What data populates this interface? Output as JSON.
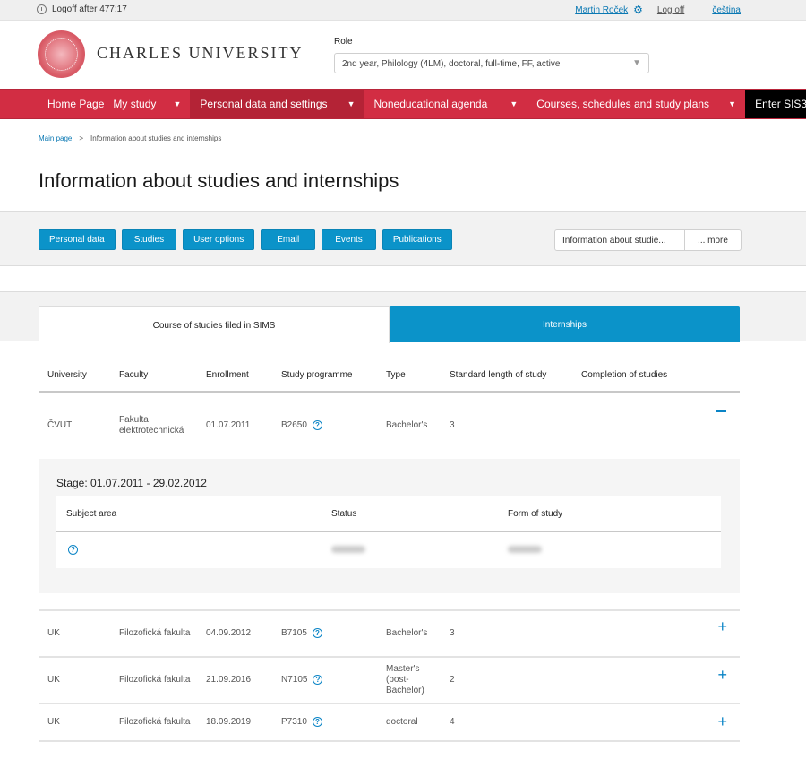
{
  "topbar": {
    "logoff_text": "Logoff after 477:17",
    "user_name": "Martin Roček",
    "logoff_link": "Log off",
    "language_link": "čeština"
  },
  "header": {
    "brand": "CHARLES UNIVERSITY",
    "role_label": "Role",
    "role_value": "2nd year, Philology (4LM), doctoral, full-time, FF, active"
  },
  "nav": {
    "items": [
      {
        "label": "Home Page"
      },
      {
        "label": "My study"
      },
      {
        "label": "Personal data and settings"
      },
      {
        "label": "Noneducational agenda"
      },
      {
        "label": "Courses, schedules and study plans"
      },
      {
        "label": "Enter SIS3"
      }
    ],
    "accent_color": "#d22d43"
  },
  "breadcrumb": {
    "home": "Main page",
    "separator": ">",
    "current": "Information about studies and internships"
  },
  "page_title": "Information about studies and internships",
  "subnav": {
    "buttons": [
      "Personal data",
      "Studies",
      "User options",
      "Email",
      "Events",
      "Publications"
    ],
    "current": "Information about studie...",
    "more": "... more"
  },
  "tabs": [
    {
      "label": "Course of studies filed in SIMS",
      "active": true
    },
    {
      "label": "Internships",
      "active": false
    }
  ],
  "table": {
    "headers": [
      "University",
      "Faculty",
      "Enrollment",
      "Study programme",
      "Type",
      "Standard length of study",
      "Completion of studies"
    ],
    "rows": [
      {
        "university": "ČVUT",
        "faculty": "Fakulta elektrotechnická",
        "enrollment": "01.07.2011",
        "programme": "B2650",
        "type": "Bachelor's",
        "length": "3",
        "completion": "",
        "expanded": true,
        "detail": {
          "stage": "Stage: 01.07.2011 - 29.02.2012",
          "headers": [
            "Subject area",
            "Status",
            "Form of study"
          ],
          "status_value": "[blurred]",
          "form_value": "[blurred]"
        }
      },
      {
        "university": "UK",
        "faculty": "Filozofická fakulta",
        "enrollment": "04.09.2012",
        "programme": "B7105",
        "type": "Bachelor's",
        "length": "3",
        "completion": "",
        "expanded": false
      },
      {
        "university": "UK",
        "faculty": "Filozofická fakulta",
        "enrollment": "21.09.2016",
        "programme": "N7105",
        "type": "Master's (post-Bachelor)",
        "length": "2",
        "completion": "",
        "expanded": false
      },
      {
        "university": "UK",
        "faculty": "Filozofická fakulta",
        "enrollment": "18.09.2019",
        "programme": "P7310",
        "type": "doctoral",
        "length": "4",
        "completion": "",
        "expanded": false
      }
    ]
  },
  "icons": {
    "help": "?",
    "expand": "+",
    "collapse": "−",
    "dropdown": "▼",
    "gear": "⚙",
    "external": "↗"
  }
}
